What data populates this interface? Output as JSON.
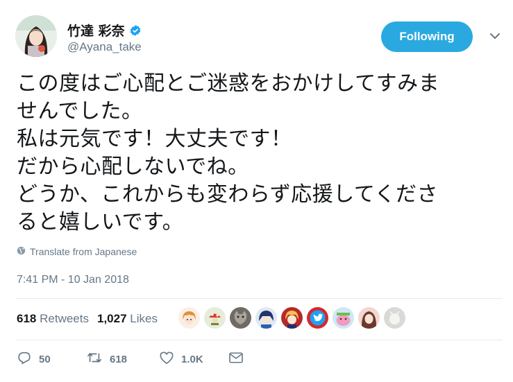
{
  "user": {
    "display_name": "竹達 彩奈",
    "handle": "@Ayana_take",
    "verified": true
  },
  "follow_button": {
    "label": "Following",
    "color": "#2aa9e0"
  },
  "tweet": {
    "lines": [
      "この度はご心配とご迷惑をおかけしてすみま",
      "せんでした。",
      "私は元気です！大丈夫です！",
      "だから心配しないでね。",
      "どうか、これからも変わらず応援してくださ",
      "ると嬉しいです。"
    ],
    "translate_label": "Translate from Japanese",
    "timestamp": "7:41 PM - 10 Jan 2018"
  },
  "stats": {
    "retweets_count": "618",
    "retweets_label": "Retweets",
    "likes_count": "1,027",
    "likes_label": "Likes"
  },
  "likers": [
    {
      "icon": "anime-avatar-orange-hair"
    },
    {
      "icon": "pixel-mushroom-avatar"
    },
    {
      "icon": "cat-avatar"
    },
    {
      "icon": "anime-avatar-blue"
    },
    {
      "icon": "anime-avatar-red-blonde"
    },
    {
      "icon": "twitter-bird-avatar"
    },
    {
      "icon": "pink-character-avatar"
    },
    {
      "icon": "girl-photo-avatar"
    },
    {
      "icon": "white-animal-avatar"
    }
  ],
  "actions": {
    "reply_count": "50",
    "retweet_count": "618",
    "like_count": "1.0K"
  }
}
